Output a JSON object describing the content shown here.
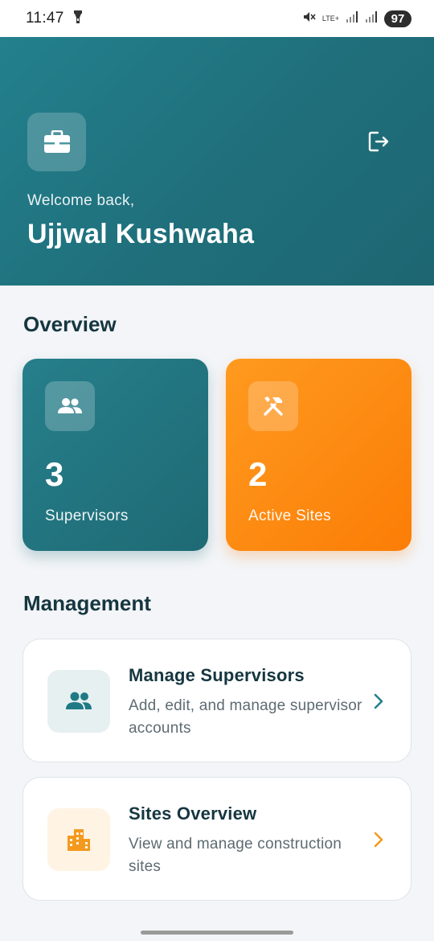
{
  "status_bar": {
    "time": "11:47",
    "network_label": "LTE+",
    "battery": "97",
    "icons": [
      "flashlight-icon",
      "mute-icon",
      "signal-icon",
      "signal-icon"
    ]
  },
  "header": {
    "icon": "briefcase-icon",
    "logout_icon": "logout-icon",
    "welcome_text": "Welcome back,",
    "user_name": "Ujjwal Kushwaha",
    "colors": {
      "gradient_start": "#23808d",
      "gradient_end": "#1d6672"
    }
  },
  "overview": {
    "title": "Overview",
    "cards": [
      {
        "icon": "group-icon",
        "value": "3",
        "label": "Supervisors",
        "color": "#23808d"
      },
      {
        "icon": "tools-icon",
        "value": "2",
        "label": "Active Sites",
        "color": "#fb8c0e"
      }
    ]
  },
  "management": {
    "title": "Management",
    "items": [
      {
        "icon": "group-icon",
        "title": "Manage Supervisors",
        "description": "Add, edit, and manage supervisor accounts",
        "chevron_color": "#23808d"
      },
      {
        "icon": "building-icon",
        "title": "Sites Overview",
        "description": "View and manage construction sites",
        "chevron_color": "#f39a1e"
      }
    ]
  }
}
